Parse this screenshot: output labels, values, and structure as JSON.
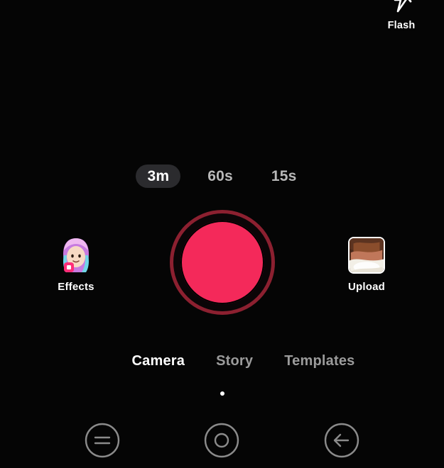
{
  "app": {
    "screen_name": "Camera",
    "background_color": "#050505"
  },
  "top_controls": {
    "flash": {
      "label": "Flash",
      "icon": "flash-off-icon",
      "state": "off"
    }
  },
  "duration_selector": {
    "options": [
      {
        "label": "3m",
        "selected": true
      },
      {
        "label": "60s",
        "selected": false
      },
      {
        "label": "15s",
        "selected": false
      }
    ],
    "selected_pill_color": "#2b2b2e",
    "inactive_text_color": "#b8b8b8"
  },
  "capture": {
    "shutter": {
      "name": "record-button",
      "fill_color": "#f4295a",
      "ring_color": "#8c2030"
    },
    "left_button": {
      "label": "Effects",
      "icon": "effects-avatar-icon"
    },
    "right_button": {
      "label": "Upload",
      "icon": "upload-thumbnail"
    }
  },
  "mode_tabs": {
    "items": [
      {
        "label": "Camera",
        "active": true
      },
      {
        "label": "Story",
        "active": false
      },
      {
        "label": "Templates",
        "active": false
      }
    ],
    "page_indicator_dots": 1
  },
  "bottom_nav": {
    "items": [
      {
        "name": "menu-circle-icon",
        "label": ""
      },
      {
        "name": "record-circle-icon",
        "label": ""
      },
      {
        "name": "back-arrow-circle-icon",
        "label": ""
      }
    ],
    "icon_color": "#8b8b8b"
  }
}
